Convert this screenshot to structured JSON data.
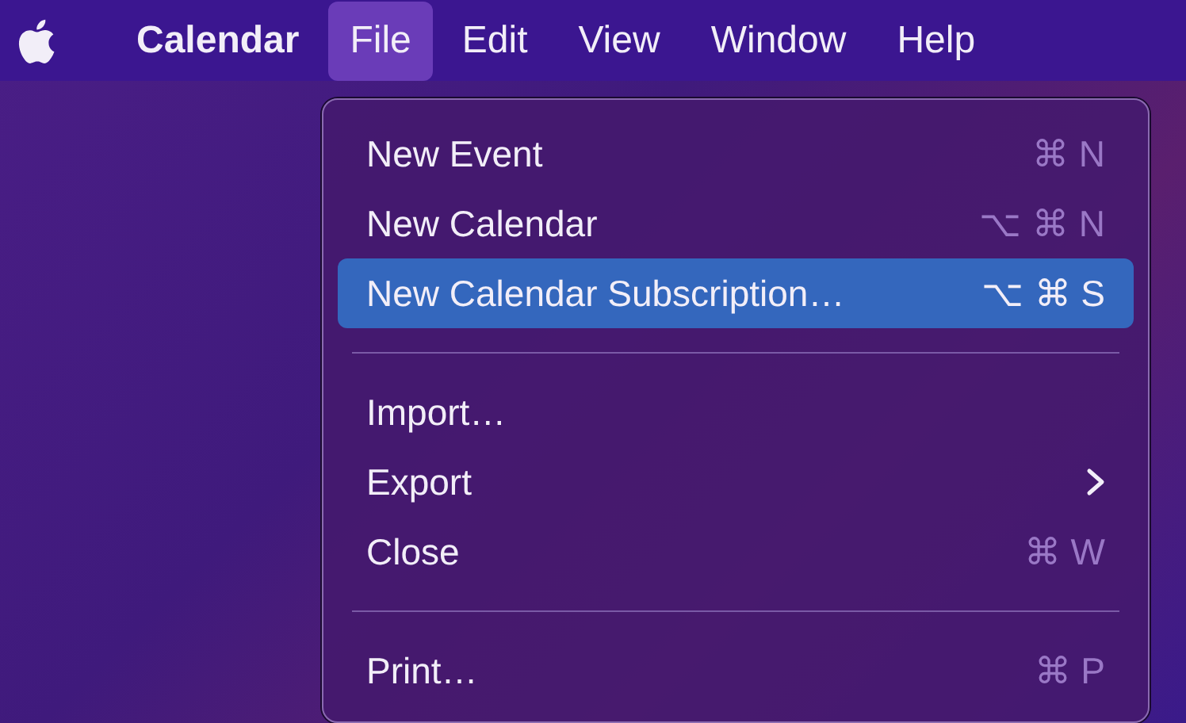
{
  "menu_bar": [
    {
      "label": "Calendar",
      "kind": "app",
      "selected": false
    },
    {
      "label": "File",
      "kind": "menu",
      "selected": true
    },
    {
      "label": "Edit",
      "kind": "menu",
      "selected": false
    },
    {
      "label": "View",
      "kind": "menu",
      "selected": false
    },
    {
      "label": "Window",
      "kind": "menu",
      "selected": false
    },
    {
      "label": "Help",
      "kind": "menu",
      "selected": false
    }
  ],
  "menu": [
    {
      "kind": "item",
      "label": "New Event",
      "shortcut": "⌘ N",
      "selected": false
    },
    {
      "kind": "item",
      "label": "New Calendar",
      "shortcut": "⌥ ⌘ N",
      "selected": false
    },
    {
      "kind": "item",
      "label": "New Calendar Subscription…",
      "shortcut": "⌥ ⌘ S",
      "selected": true
    },
    {
      "kind": "separator"
    },
    {
      "kind": "item",
      "label": "Import…",
      "selected": false
    },
    {
      "kind": "submenu",
      "label": "Export",
      "selected": false
    },
    {
      "kind": "item",
      "label": "Close",
      "shortcut": "⌘ W",
      "selected": false
    },
    {
      "kind": "separator"
    },
    {
      "kind": "item",
      "label": "Print…",
      "shortcut": "⌘ P",
      "selected": false
    }
  ]
}
